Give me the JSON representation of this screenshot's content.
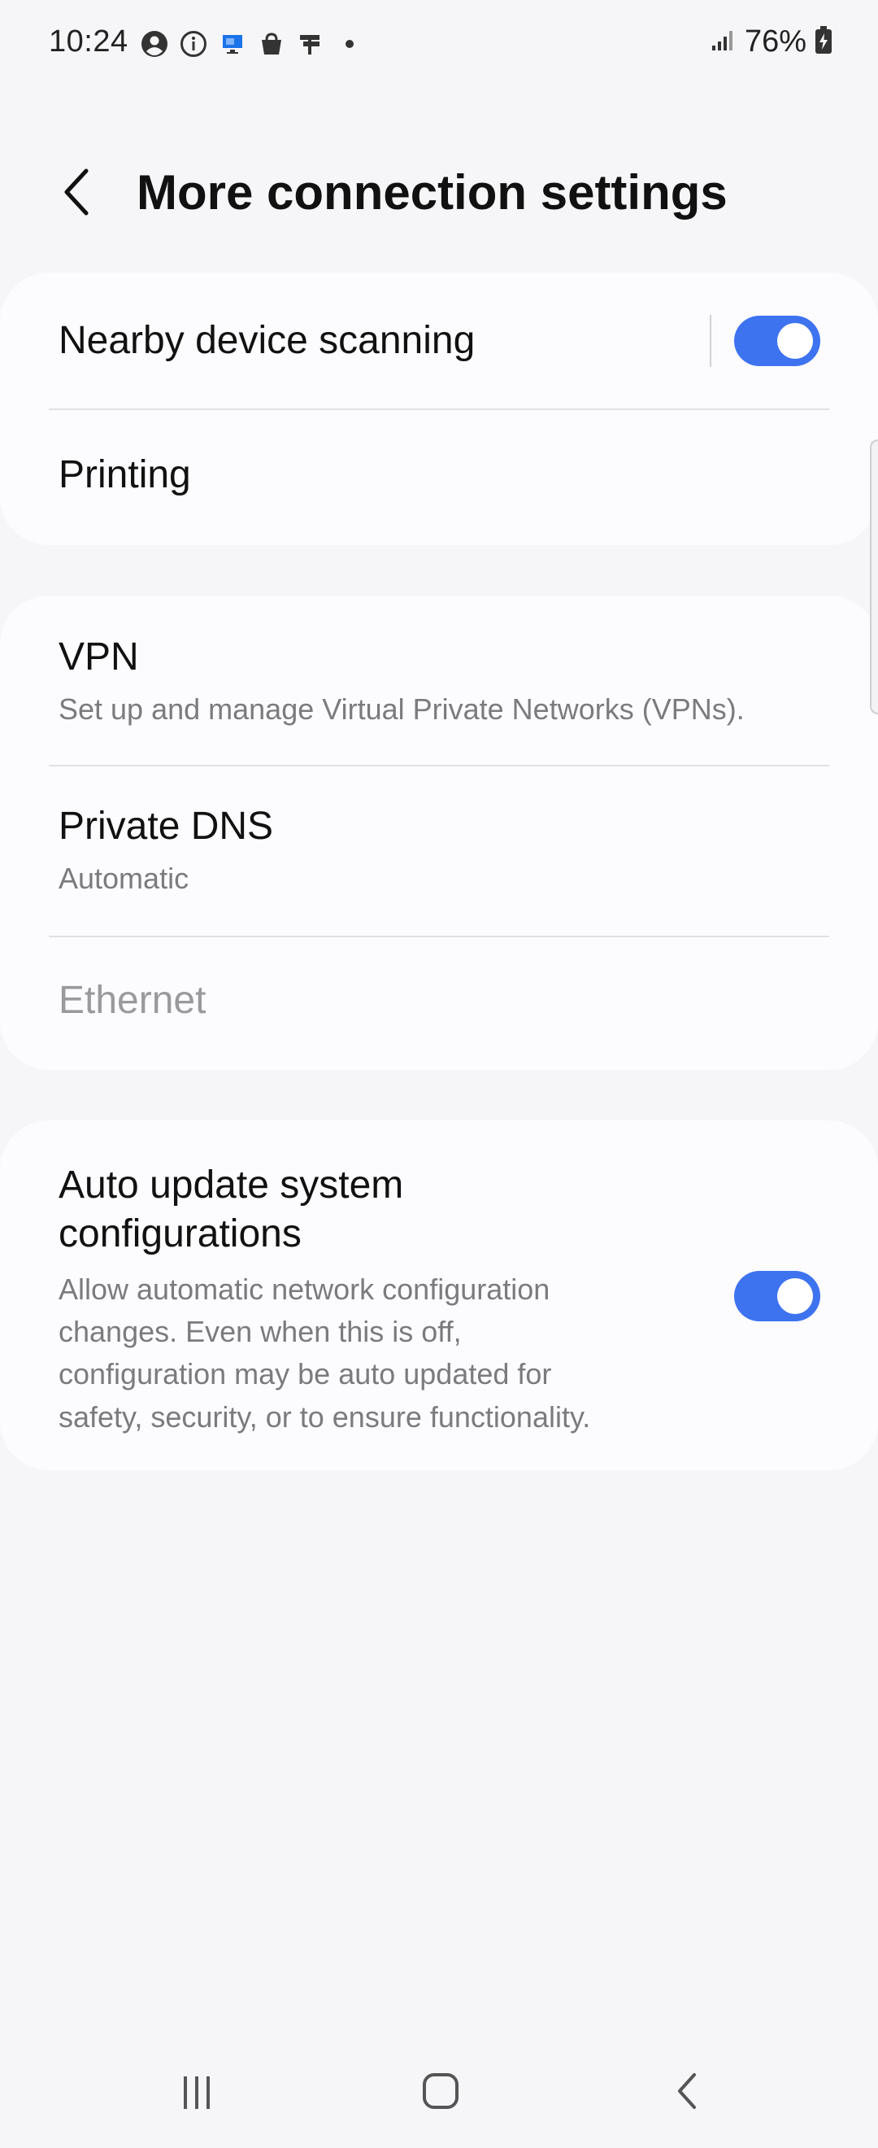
{
  "status_bar": {
    "time": "10:24",
    "notification_icons": [
      "account-circle-icon",
      "info-icon",
      "remote-desktop-icon",
      "shopping-bag-icon",
      "flag-icon",
      "more-dot-icon"
    ],
    "signal_icon": "signal-bars-icon",
    "battery_percent": "76%",
    "battery_icon": "battery-charging-icon"
  },
  "header": {
    "back_icon": "chevron-left-icon",
    "title": "More connection settings"
  },
  "groups": [
    {
      "items": [
        {
          "title": "Nearby device scanning",
          "toggle": true
        },
        {
          "title": "Printing"
        }
      ]
    },
    {
      "items": [
        {
          "title": "VPN",
          "subtitle": "Set up and manage Virtual Private Networks (VPNs)."
        },
        {
          "title": "Private DNS",
          "subtitle": "Automatic"
        },
        {
          "title": "Ethernet",
          "disabled": true
        }
      ]
    },
    {
      "items": [
        {
          "title_line1": "Auto update system",
          "title_line2": "configurations",
          "subtitle_lines": [
            "Allow automatic network configuration",
            "changes. Even when this is off,",
            "configuration may be auto updated for",
            "safety, security, or to ensure functionality."
          ],
          "toggle": true
        }
      ]
    }
  ],
  "nav_bar": {
    "recents_icon": "recents-icon",
    "home_icon": "home-icon",
    "back_icon": "back-icon"
  },
  "colors": {
    "background": "#f6f6f8",
    "card": "#fcfcfe",
    "accent": "#3e73f0",
    "subtitle": "#7b7b7f",
    "disabled": "#9a9a9e"
  }
}
